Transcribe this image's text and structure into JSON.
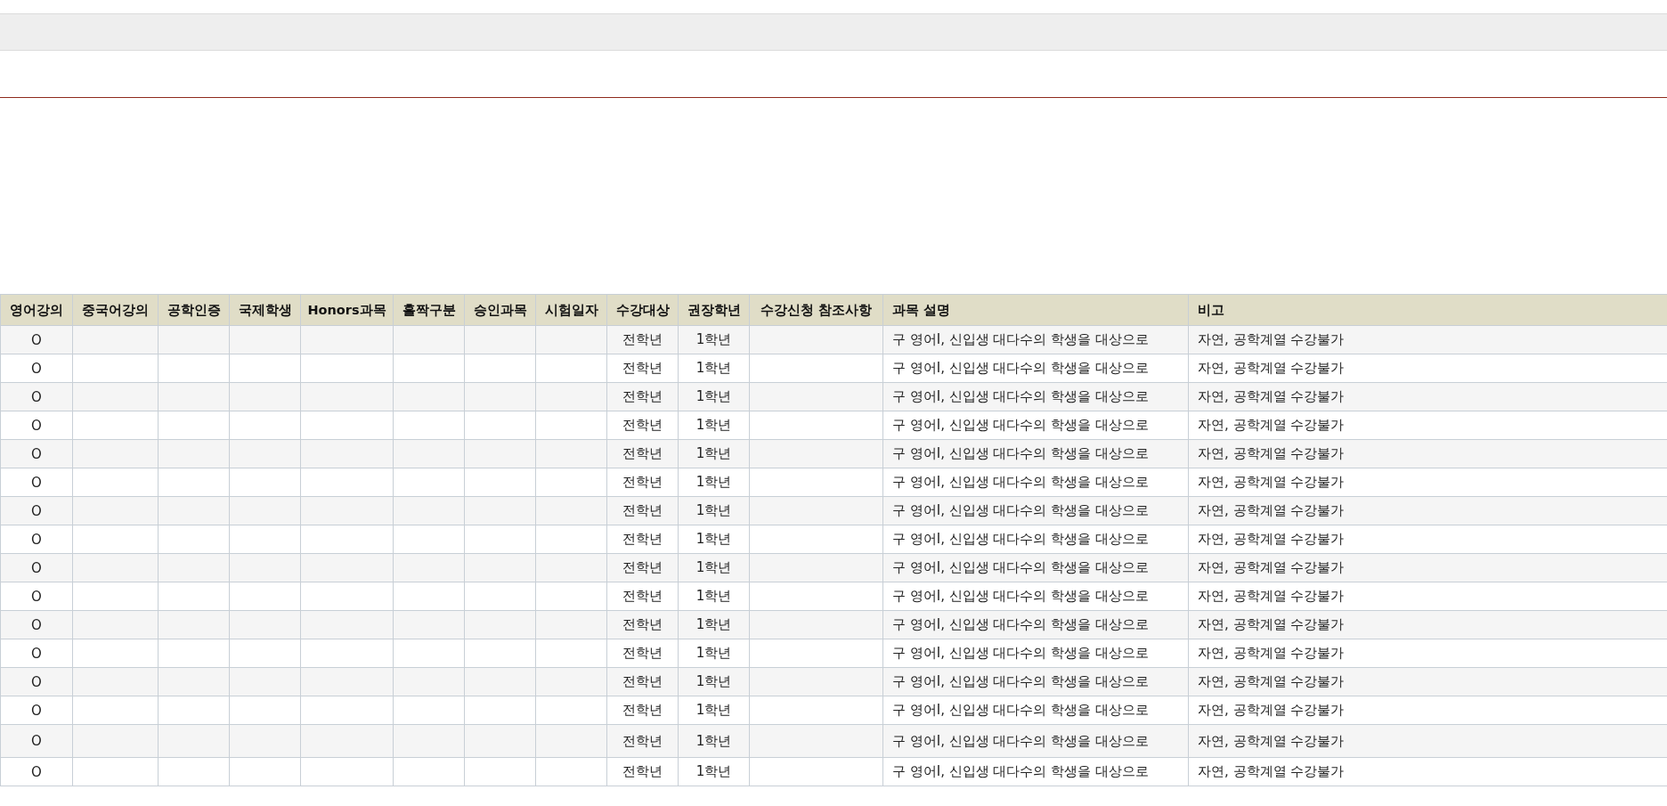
{
  "table": {
    "columns": [
      "영어강의",
      "중국어강의",
      "공학인증",
      "국제학생",
      "Honors과목",
      "홀짝구분",
      "승인과목",
      "시험일자",
      "수강대상",
      "권장학년",
      "수강신청 참조사항",
      "과목 설명",
      "비고"
    ],
    "rows": [
      [
        "O",
        null,
        null,
        null,
        null,
        null,
        null,
        null,
        "전학년",
        "1학년",
        null,
        "구 영어I, 신입생 대다수의 학생을 대상으로",
        "자연, 공학계열 수강불가"
      ],
      [
        "O",
        null,
        null,
        null,
        null,
        null,
        null,
        null,
        "전학년",
        "1학년",
        null,
        "구 영어I, 신입생 대다수의 학생을 대상으로",
        "자연, 공학계열 수강불가"
      ],
      [
        "O",
        null,
        null,
        null,
        null,
        null,
        null,
        null,
        "전학년",
        "1학년",
        null,
        "구 영어I, 신입생 대다수의 학생을 대상으로",
        "자연, 공학계열 수강불가"
      ],
      [
        "O",
        null,
        null,
        null,
        null,
        null,
        null,
        null,
        "전학년",
        "1학년",
        null,
        "구 영어I, 신입생 대다수의 학생을 대상으로",
        "자연, 공학계열 수강불가"
      ],
      [
        "O",
        null,
        null,
        null,
        null,
        null,
        null,
        null,
        "전학년",
        "1학년",
        null,
        "구 영어I, 신입생 대다수의 학생을 대상으로",
        "자연, 공학계열 수강불가"
      ],
      [
        "O",
        null,
        null,
        null,
        null,
        null,
        null,
        null,
        "전학년",
        "1학년",
        null,
        "구 영어I, 신입생 대다수의 학생을 대상으로",
        "자연, 공학계열 수강불가"
      ],
      [
        "O",
        null,
        null,
        null,
        null,
        null,
        null,
        null,
        "전학년",
        "1학년",
        null,
        "구 영어I, 신입생 대다수의 학생을 대상으로",
        "자연, 공학계열 수강불가"
      ],
      [
        "O",
        null,
        null,
        null,
        null,
        null,
        null,
        null,
        "전학년",
        "1학년",
        null,
        "구 영어I, 신입생 대다수의 학생을 대상으로",
        "자연, 공학계열 수강불가"
      ],
      [
        "O",
        null,
        null,
        null,
        null,
        null,
        null,
        null,
        "전학년",
        "1학년",
        null,
        "구 영어I, 신입생 대다수의 학생을 대상으로",
        "자연, 공학계열 수강불가"
      ],
      [
        "O",
        null,
        null,
        null,
        null,
        null,
        null,
        null,
        "전학년",
        "1학년",
        null,
        "구 영어I, 신입생 대다수의 학생을 대상으로",
        "자연, 공학계열 수강불가"
      ],
      [
        "O",
        null,
        null,
        null,
        null,
        null,
        null,
        null,
        "전학년",
        "1학년",
        null,
        "구 영어I, 신입생 대다수의 학생을 대상으로",
        "자연, 공학계열 수강불가"
      ],
      [
        "O",
        null,
        null,
        null,
        null,
        null,
        null,
        null,
        "전학년",
        "1학년",
        null,
        "구 영어I, 신입생 대다수의 학생을 대상으로",
        "자연, 공학계열 수강불가"
      ],
      [
        "O",
        null,
        null,
        null,
        null,
        null,
        null,
        null,
        "전학년",
        "1학년",
        null,
        "구 영어I, 신입생 대다수의 학생을 대상으로",
        "자연, 공학계열 수강불가"
      ],
      [
        "O",
        null,
        null,
        null,
        null,
        null,
        null,
        null,
        "전학년",
        "1학년",
        null,
        "구 영어I, 신입생 대다수의 학생을 대상으로",
        "자연, 공학계열 수강불가"
      ],
      [
        "O",
        null,
        null,
        null,
        null,
        null,
        null,
        null,
        "전학년",
        "1학년",
        null,
        "구 영어I, 신입생 대다수의 학생을 대상으로",
        "자연, 공학계열 수강불가"
      ],
      [
        "O",
        null,
        null,
        null,
        null,
        null,
        null,
        null,
        "전학년",
        "1학년",
        null,
        "구 영어I, 신입생 대다수의 학생을 대상으로",
        "자연, 공학계열 수강불가"
      ]
    ]
  }
}
